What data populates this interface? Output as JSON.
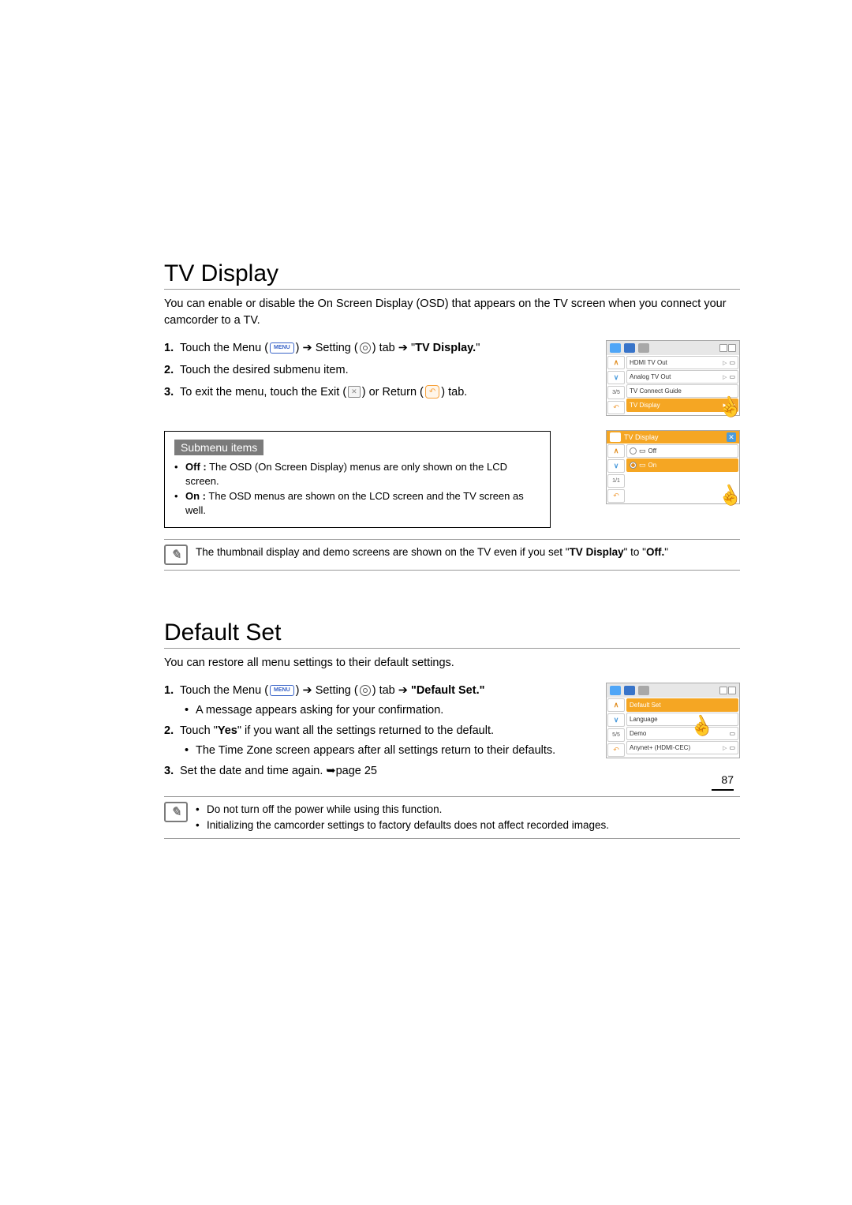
{
  "page_number": "87",
  "arrow_glyph": "➔",
  "page_ref_glyph": "➥",
  "tv_display": {
    "title": "TV Display",
    "intro": "You can enable or disable the On Screen Display (OSD) that appears on the TV screen when you connect your camcorder to a TV.",
    "step1_a": "Touch the Menu (",
    "step1_b": ") ",
    "step1_c": " Setting (",
    "step1_d": ") tab ",
    "step1_e": " \"",
    "step1_target": "TV Display.",
    "step1_f": "\"",
    "step2": "Touch the desired submenu item.",
    "step3_a": "To exit the menu, touch the Exit (",
    "step3_b": ") or Return (",
    "step3_c": ") tab.",
    "submenu_label": "Submenu items",
    "off_label": "Off :",
    "off_text": " The OSD (On Screen Display) menus are only shown on the LCD screen.",
    "on_label": "On :",
    "on_text": " The OSD menus are shown on the LCD screen and the TV screen as well.",
    "note_a": "The thumbnail display and demo screens are shown on the TV even if you set \"",
    "note_b": "TV Display",
    "note_c": "\" to \"",
    "note_d": "Off.",
    "note_e": "\"",
    "menu_icon_label": "MENU",
    "exit_icon_label": "✕",
    "return_icon_label": "↶",
    "screenshot1": {
      "page_indicator": "3/5",
      "rows": {
        "r1": "HDMI TV Out",
        "r2": "Analog TV Out",
        "r3": "TV Connect Guide",
        "r4": "TV Display"
      }
    },
    "screenshot2": {
      "title": "TV Display",
      "page_indicator": "1/1",
      "off": "Off",
      "on": "On"
    }
  },
  "default_set": {
    "title": "Default Set",
    "intro": "You can restore all menu settings to their default settings.",
    "step1_a": "Touch the Menu (",
    "step1_b": ") ",
    "step1_c": " Setting (",
    "step1_d": ") tab ",
    "step1_e": " ",
    "step1_target": "\"Default Set.\"",
    "step1_sub": "A message appears asking for your confirmation.",
    "step2_a": "Touch \"",
    "step2_b": "Yes",
    "step2_c": "\" if you want all the settings returned to the default.",
    "step2_sub": "The Time Zone screen appears after all settings return to their defaults.",
    "step3_a": "Set the date and time again. ",
    "step3_b": "page 25",
    "note1": "Do not turn off the power while using this function.",
    "note2": "Initializing the camcorder settings to factory defaults does not affect recorded images.",
    "screenshot": {
      "page_indicator": "5/5",
      "rows": {
        "r1": "Default Set",
        "r2": "Language",
        "r3": "Demo",
        "r4": "Anynet+ (HDMI-CEC)"
      }
    }
  }
}
